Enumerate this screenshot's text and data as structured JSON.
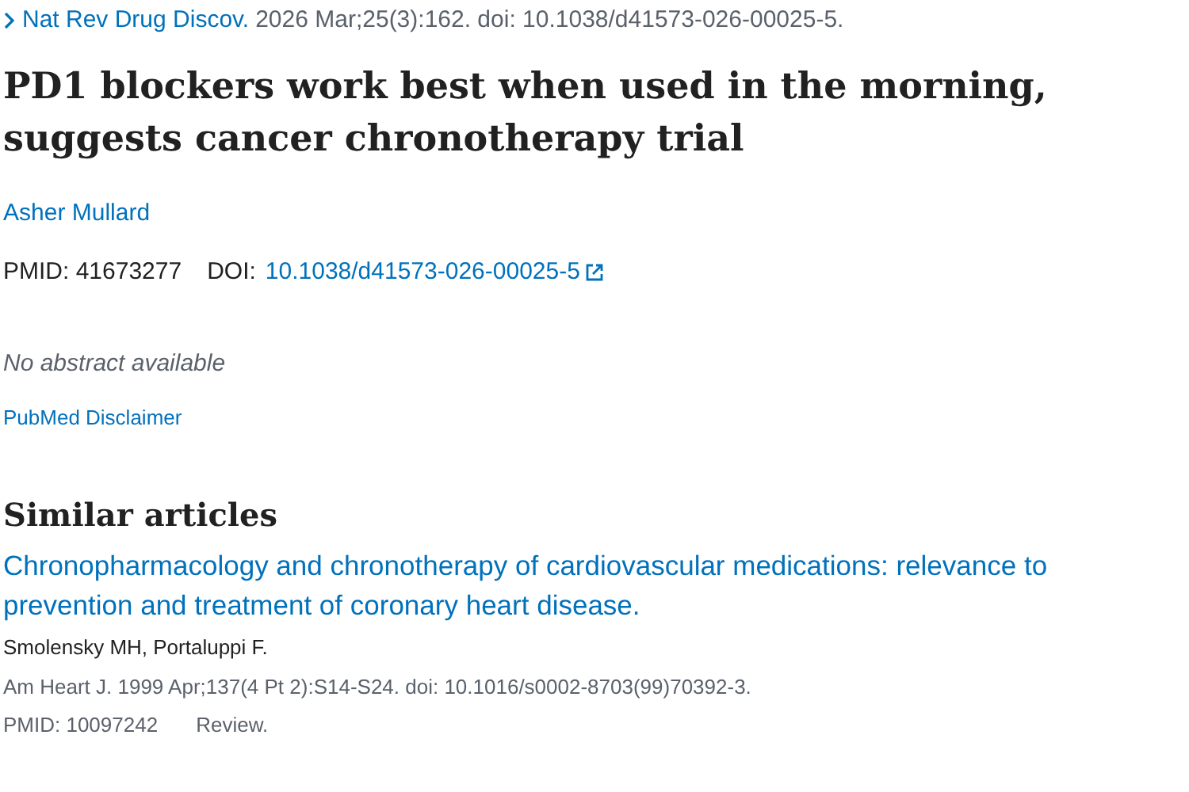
{
  "citation": {
    "journal": "Nat Rev Drug Discov.",
    "details": "2026 Mar;25(3):162. doi: 10.1038/d41573-026-00025-5."
  },
  "title": "PD1 blockers work best when used in the morning, suggests cancer chronotherapy trial",
  "authors": [
    "Asher Mullard"
  ],
  "identifiers": {
    "pmid_label": "PMID: 41673277",
    "doi_label": "DOI:",
    "doi": "10.1038/d41573-026-00025-5"
  },
  "abstract": "No abstract available",
  "disclaimer": "PubMed Disclaimer",
  "similar": {
    "heading": "Similar articles",
    "articles": [
      {
        "title": "Chronopharmacology and chronotherapy of cardiovascular medications: relevance to prevention and treatment of coronary heart disease.",
        "authors": "Smolensky MH, Portaluppi F.",
        "source": "Am Heart J. 1999 Apr;137(4 Pt 2):S14-S24. doi: 10.1016/s0002-8703(99)70392-3.",
        "pmid": "PMID: 10097242",
        "type": "Review."
      }
    ]
  }
}
